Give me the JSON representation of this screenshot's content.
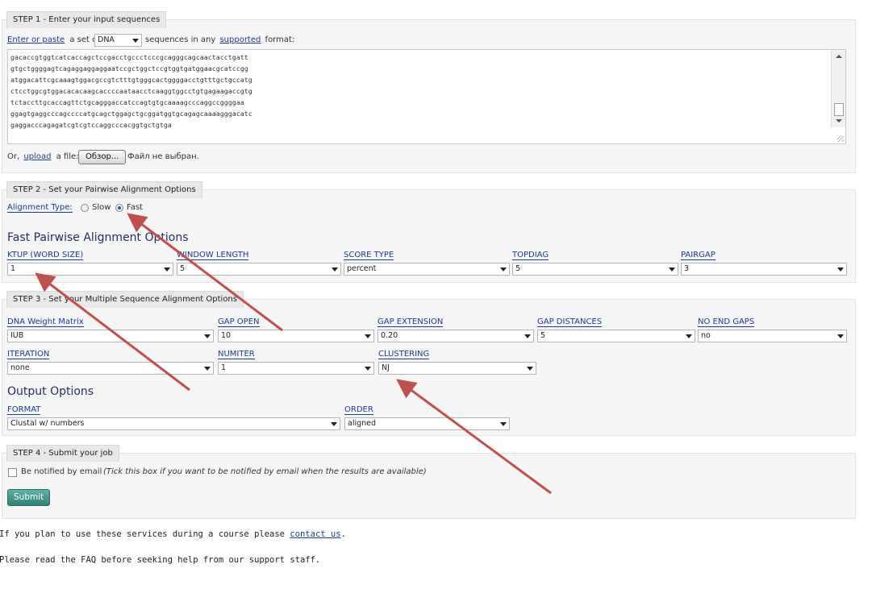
{
  "step1": {
    "title": "STEP 1 - Enter your input sequences",
    "enter_link": "Enter or paste",
    "a_set_of": "a set of",
    "seq_type": "DNA",
    "sequences_in_any": "sequences in any",
    "supported_link": "supported",
    "format_text": "format:",
    "sequence_lines": [
      "gacaccgtggtcatcaccagctccgacctgccctcccgcagggcagcaactacctgatt",
      "gtgctggggagtcagaggaggaggaatccgctggctccgtggtgatggaacgcatccgg",
      "atggacattcgcaaagtggacgccgtctttgtgggcactggggacctgtttgctgccatg",
      "ctcctggcgtggacacacaagcaccccaataacctcaaggtggcctgtgagaagaccgtg",
      "tctaccttgcaccagttctgcagggaccatccagtgtgcaaaagcccaggccggggaa",
      "ggagtgaggcccagccccatgcagctggagctgcggatggtgcagagcaaaagggacatc",
      "gaggacccagagatcgtcgtccaggcccacggtgctgtga"
    ],
    "or_text": "Or,",
    "upload_link": "upload",
    "a_file_text": "a file:",
    "browse_button": "Обзор...",
    "no_file_text": "Файл не выбран."
  },
  "step2": {
    "title": "STEP 2 - Set your Pairwise Alignment Options",
    "alignment_type_label": "Alignment Type:",
    "slow_label": "Slow",
    "fast_label": "Fast",
    "selected": "Fast",
    "section_heading": "Fast Pairwise Alignment Options",
    "fields": [
      {
        "label": "KTUP (WORD SIZE)",
        "value": "1"
      },
      {
        "label": "WINDOW LENGTH",
        "value": "5"
      },
      {
        "label": "SCORE TYPE",
        "value": "percent"
      },
      {
        "label": "TOPDIAG",
        "value": "5"
      },
      {
        "label": "PAIRGAP",
        "value": "3"
      }
    ]
  },
  "step3": {
    "title": "STEP 3 - Set your Multiple Sequence Alignment Options",
    "fields": [
      {
        "label": "DNA Weight Matrix",
        "value": "IUB"
      },
      {
        "label": "GAP OPEN",
        "value": "10"
      },
      {
        "label": "GAP EXTENSION",
        "value": "0.20"
      },
      {
        "label": "GAP DISTANCES",
        "value": "5"
      },
      {
        "label": "NO END GAPS",
        "value": "no"
      },
      {
        "label": "ITERATION",
        "value": "none"
      },
      {
        "label": "NUMITER",
        "value": "1"
      },
      {
        "label": "CLUSTERING",
        "value": "NJ"
      }
    ],
    "output_heading": "Output Options",
    "output_fields": [
      {
        "label": "FORMAT",
        "value": "Clustal w/ numbers"
      },
      {
        "label": "ORDER",
        "value": "aligned"
      }
    ]
  },
  "step4": {
    "title": "STEP 4 - Submit your job",
    "notify_label": "Be notified by email",
    "notify_hint": "(Tick this box if you want to be notified by email when the results are available)",
    "submit_button": "Submit"
  },
  "footer": {
    "course_text": "If you plan to use these services during a course please",
    "contact_link": "contact us",
    "period": ".",
    "faq_text": "Please read the FAQ before seeking help from our support staff."
  },
  "colors": {
    "arrow": "#c0504d",
    "submit_bg": "#3a8f82",
    "link": "#1a3c8c"
  }
}
